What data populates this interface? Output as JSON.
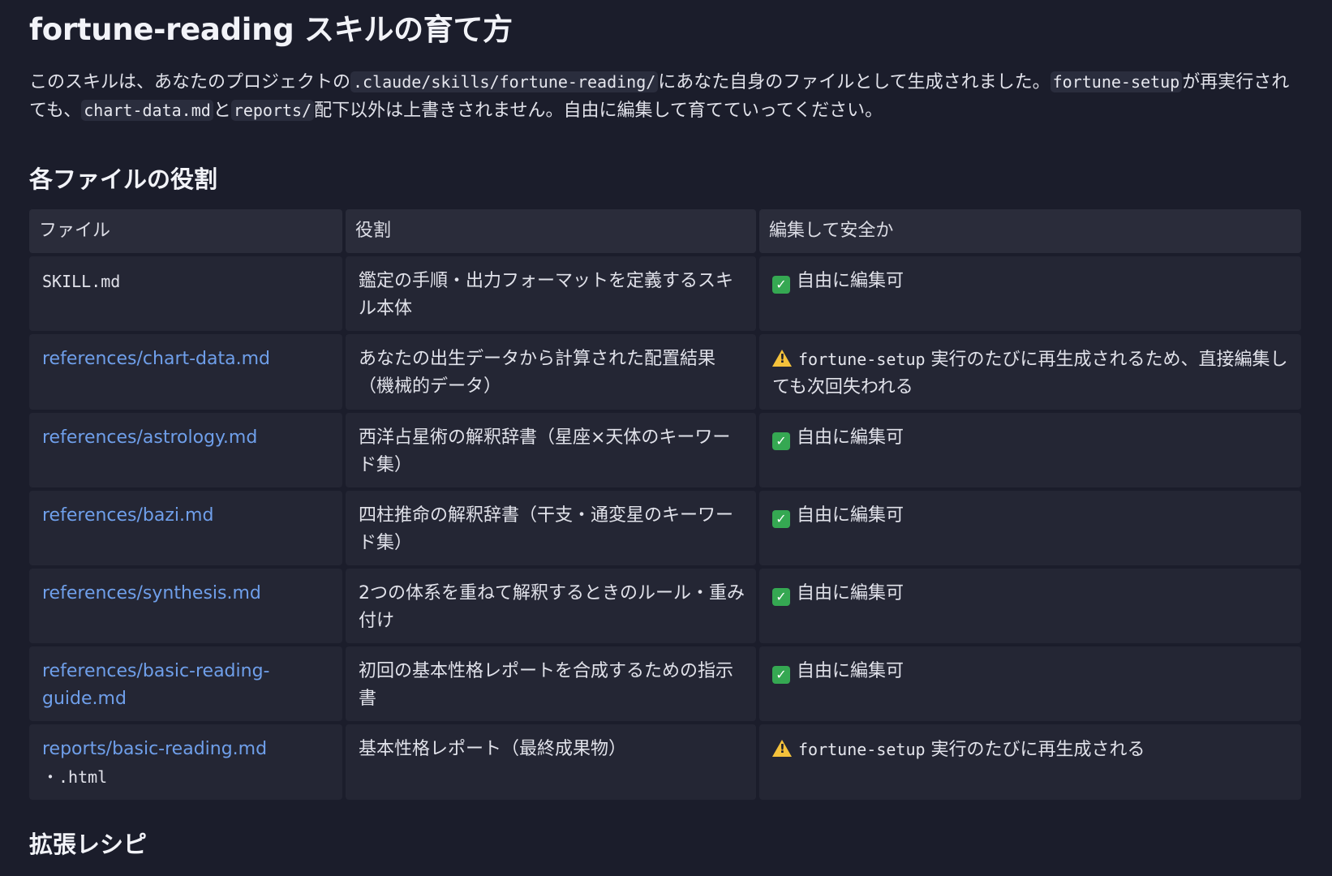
{
  "title": "fortune-reading スキルの育て方",
  "intro": {
    "p1": "このスキルは、あなたのプロジェクトの",
    "code1": ".claude/skills/fortune-reading/",
    "p2": "にあなた自身のファイルとして生成されました。",
    "code2": "fortune-setup",
    "p3": "が再実行されても、",
    "code3": "chart-data.md",
    "p4": "と",
    "code4": "reports/",
    "p5": "配下以外は上書きされません。自由に編集して育てていってください。"
  },
  "section_roles": "各ファイルの役割",
  "table": {
    "headers": [
      "ファイル",
      "役割",
      "編集して安全か"
    ],
    "rows": [
      {
        "file": "SKILL.md",
        "role": "鑑定の手順・出力フォーマットを定義するスキル本体",
        "safe": "自由に編集可"
      },
      {
        "file": "references/chart-data.md",
        "role": "あなたの出生データから計算された配置結果（機械的データ）",
        "safe_code": "fortune-setup",
        "safe": "実行のたびに再生成されるため、直接編集しても次回失われる"
      },
      {
        "file": "references/astrology.md",
        "role": "西洋占星術の解釈辞書（星座×天体のキーワード集）",
        "safe": "自由に編集可"
      },
      {
        "file": "references/bazi.md",
        "role": "四柱推命の解釈辞書（干支・通変星のキーワード集）",
        "safe": "自由に編集可"
      },
      {
        "file": "references/synthesis.md",
        "role": "2つの体系を重ねて解釈するときのルール・重み付け",
        "safe": "自由に編集可"
      },
      {
        "file": "references/basic-reading-guide.md",
        "role": "初回の基本性格レポートを合成するための指示書",
        "safe": "自由に編集可"
      },
      {
        "file": "reports/basic-reading.md",
        "file_extra": "・.html",
        "role": "基本性格レポート（最終成果物）",
        "safe_code": "fortune-setup",
        "safe": "実行のたびに再生成される"
      }
    ]
  },
  "section_recipes": "拡張レシピ",
  "icons": {
    "ok": "check-box-icon",
    "warn": "warning-icon"
  },
  "colors": {
    "background": "#1b1d2b",
    "link": "#6f9fea",
    "check": "#35a852",
    "warn": "#f5c23b"
  }
}
